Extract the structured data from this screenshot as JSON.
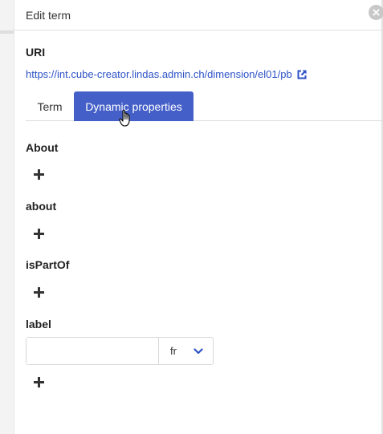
{
  "header": {
    "title": "Edit term"
  },
  "uri": {
    "label": "URI",
    "value": "https://int.cube-creator.lindas.admin.ch/dimension/el01/pb"
  },
  "tabs": [
    {
      "label": "Term",
      "active": false
    },
    {
      "label": "Dynamic properties",
      "active": true
    }
  ],
  "properties": [
    {
      "name": "About"
    },
    {
      "name": "about"
    },
    {
      "name": "isPartOf"
    },
    {
      "name": "label",
      "input_value": "",
      "language": "fr"
    }
  ],
  "colors": {
    "accent": "#445fc8",
    "link": "#2c52c6"
  },
  "icons": [
    "close-icon",
    "external-link-icon",
    "plus-icon",
    "chevron-down-icon",
    "hand-pointer-icon"
  ]
}
